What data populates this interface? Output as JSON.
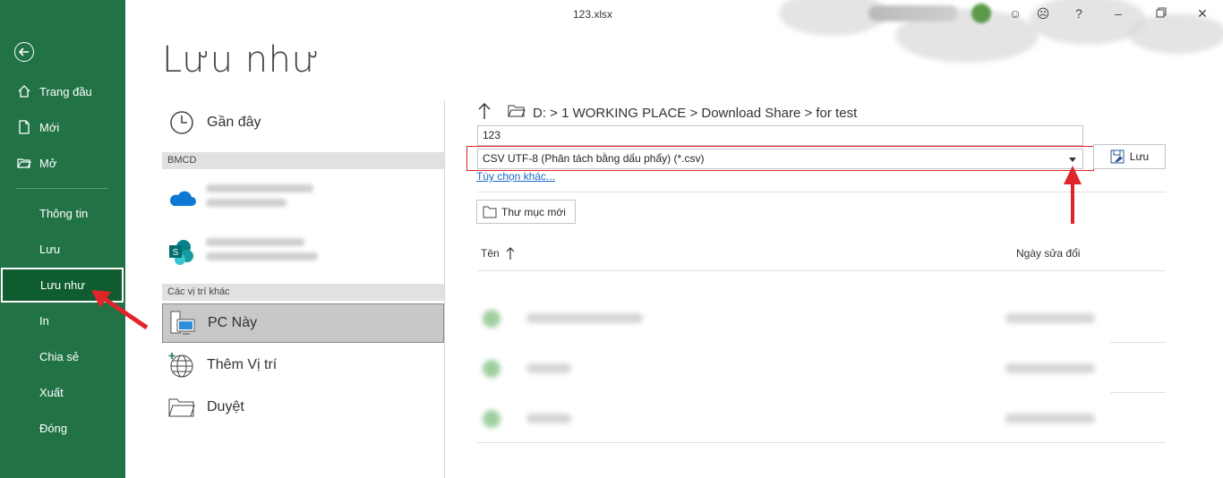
{
  "window": {
    "filename": "123.xlsx"
  },
  "nav": {
    "items": [
      {
        "label": "Trang đầu",
        "icon": "home-icon"
      },
      {
        "label": "Mới",
        "icon": "new-file-icon"
      },
      {
        "label": "Mở",
        "icon": "open-folder-icon"
      },
      {
        "label": "Thông tin"
      },
      {
        "label": "Lưu"
      },
      {
        "label": "Lưu như"
      },
      {
        "label": "In"
      },
      {
        "label": "Chia sẻ"
      },
      {
        "label": "Xuất"
      },
      {
        "label": "Đóng"
      }
    ],
    "active": "Lưu như"
  },
  "page_title": "Lưu như",
  "locations": {
    "recent": "Gần đây",
    "group1": "BMCD",
    "group2": "Các vị trí khác",
    "this_pc": "PC Này",
    "add_place": "Thêm Vị trí",
    "browse": "Duyệt"
  },
  "save_pane": {
    "path": "D: > 1 WORKING PLACE > Download Share > for test",
    "filename_value": "123",
    "filetype_value": "CSV UTF-8 (Phân tách bằng dấu phẩy) (*.csv)",
    "save_label": "Lưu",
    "more_options": "Tùy chọn khác...",
    "new_folder": "Thư mục mới",
    "col_name": "Tên",
    "col_date": "Ngày sửa đổi"
  },
  "colors": {
    "accent": "#217346",
    "active_nav": "#0e5c2f",
    "highlight": "#e0242a",
    "link": "#1b6ac9"
  }
}
